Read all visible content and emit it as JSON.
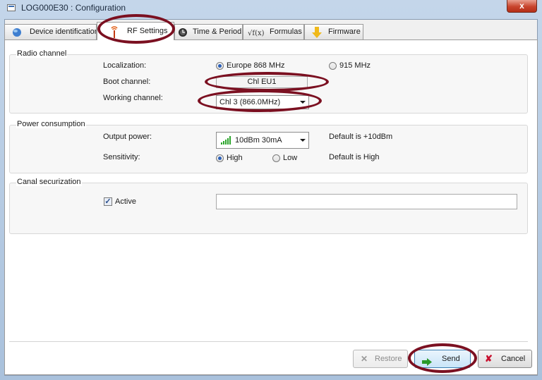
{
  "window": {
    "title": "LOG000E30 : Configuration",
    "close_glyph": "x"
  },
  "tabs": [
    {
      "label": "Device identification",
      "icon": "globe-icon"
    },
    {
      "label": "RF Settings",
      "icon": "antenna-icon",
      "active": true
    },
    {
      "label": "Time & Period",
      "icon": "clock-icon"
    },
    {
      "label": "Formulas",
      "icon": "formula-icon",
      "icon_text": "√f(x)"
    },
    {
      "label": "Firmware",
      "icon": "download-arrow-icon"
    }
  ],
  "radio_channel": {
    "title": "Radio channel",
    "localization_label": "Localization:",
    "option_eu": "Europe 868 MHz",
    "option_us": "915 MHz",
    "selected": "Europe 868 MHz",
    "boot_label": "Boot channel:",
    "boot_value": "Chl EU1",
    "working_label": "Working channel:",
    "working_value": "Chl  3  (866.0MHz)"
  },
  "power": {
    "title": "Power consumption",
    "output_label": "Output power:",
    "output_value": "10dBm 30mA",
    "output_default": "Default is +10dBm",
    "sensitivity_label": "Sensitivity:",
    "opt_high": "High",
    "opt_low": "Low",
    "selected": "High",
    "sensitivity_default": "Default is High"
  },
  "canal": {
    "title": "Canal securization",
    "active_label": "Active",
    "active_checked": true,
    "check_glyph": "✓",
    "key_value": ""
  },
  "buttons": {
    "restore": "Restore",
    "send": "Send",
    "cancel": "Cancel"
  },
  "colors": {
    "highlight_ring": "#7b1021",
    "send_arrow": "#2a9a2a",
    "cancel_x": "#c8102e"
  }
}
